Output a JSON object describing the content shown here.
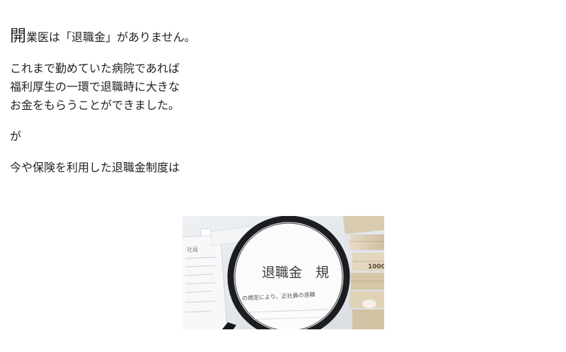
{
  "article": {
    "lead_cap": "開",
    "lead_rest": "業医は「退職金」がありません。",
    "paragraph1": [
      "これまで勤めていた病院であれば",
      "福利厚生の一環で退職時に大きな",
      "お金をもらうことができました。"
    ],
    "paragraph2": "が",
    "paragraph3": "今や保険を利用した退職金制度は"
  },
  "figure": {
    "lens_text_main": "退職金　規",
    "lens_text_sub": "の規定により、正社員の退職",
    "doc_header": "社員",
    "banknote_label": "1000"
  }
}
